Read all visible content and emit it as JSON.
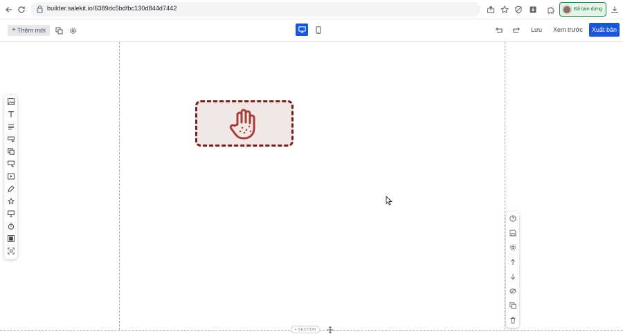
{
  "browser": {
    "url": "builder.salekit.io/6389dc5bdfbc130d844d7442",
    "profile_label": "Đã tạm dừng",
    "icons": [
      "back-arrow-icon",
      "reload-icon",
      "lock-icon",
      "share-icon",
      "star-icon",
      "shield-icon",
      "download-box-icon",
      "extensions-icon",
      "download-icon"
    ]
  },
  "toolbar": {
    "add_new_label": "Thêm mới",
    "save_label": "Lưu",
    "preview_label": "Xem trước",
    "publish_label": "Xuất bản",
    "colors": {
      "primary": "#1a56db",
      "placeholder_border": "#7a1c1c",
      "placeholder_bg": "#f1e7e4"
    }
  },
  "canvas": {
    "section_label": "+ SECTION",
    "placeholder_icon": "hand-icon"
  },
  "left_panel": {
    "icons": [
      "image-icon",
      "text-icon",
      "paragraph-icon",
      "button-icon",
      "layers-icon",
      "form-icon",
      "video-icon",
      "pen-icon",
      "star-icon",
      "monitor-icon",
      "timer-icon",
      "gallery-icon",
      "frame-icon"
    ]
  },
  "right_panel": {
    "icons": [
      "help-icon",
      "save-icon",
      "settings-icon",
      "arrow-up-icon",
      "arrow-down-icon",
      "hide-icon",
      "duplicate-icon",
      "trash-icon"
    ]
  }
}
